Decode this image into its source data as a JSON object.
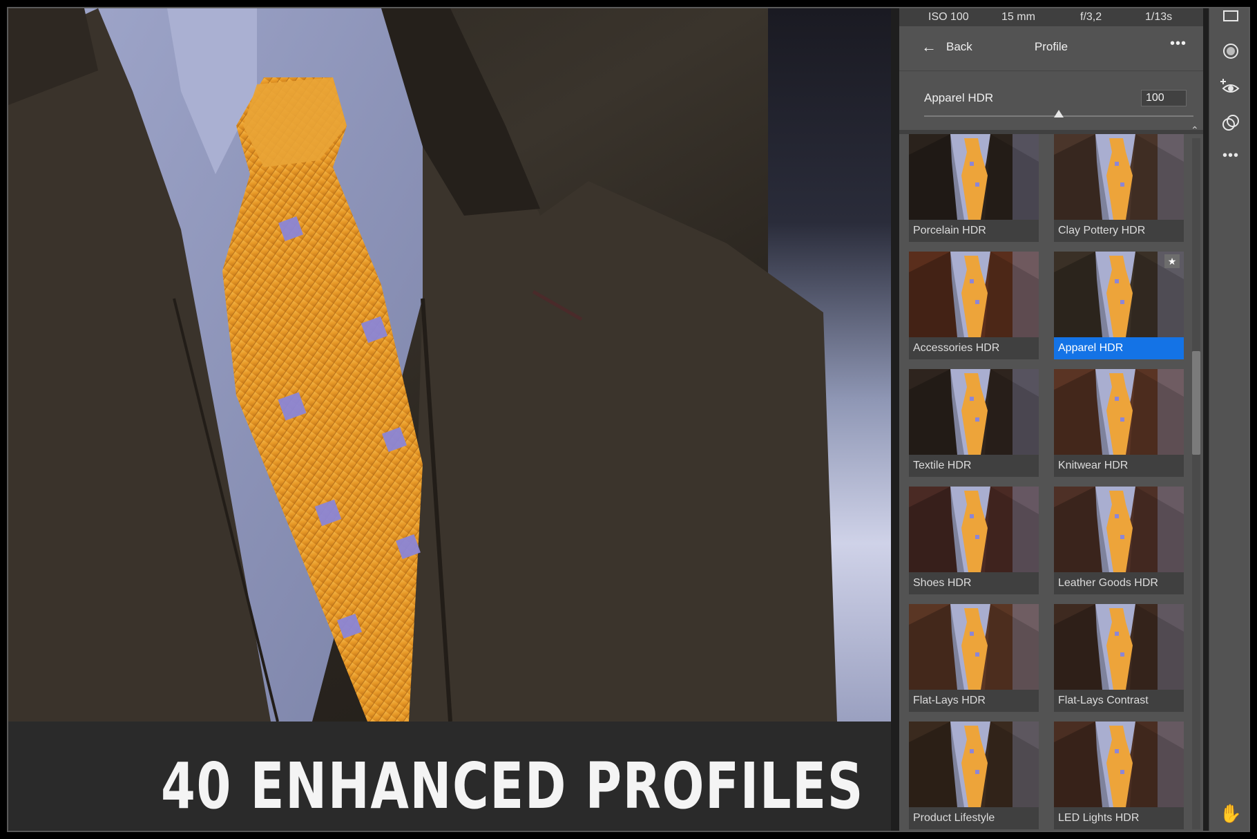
{
  "exif": {
    "iso": "ISO 100",
    "focal": "15 mm",
    "aperture": "f/3,2",
    "shutter": "1/13s"
  },
  "header": {
    "back_label": "Back",
    "title": "Profile",
    "more_label": "•••"
  },
  "amount": {
    "label": "Apparel HDR",
    "value": "100",
    "slider_fraction": 0.5
  },
  "profiles": [
    {
      "name": "Porcelain HDR",
      "tint": "#2a221c",
      "selected": false,
      "favorite": false
    },
    {
      "name": "Clay Pottery HDR",
      "tint": "#4a352a",
      "selected": false,
      "favorite": false
    },
    {
      "name": "Accessories HDR",
      "tint": "#5a2e1c",
      "selected": false,
      "favorite": false
    },
    {
      "name": "Apparel HDR",
      "tint": "#3a3026",
      "selected": true,
      "favorite": true
    },
    {
      "name": "Textile HDR",
      "tint": "#2e241e",
      "selected": false,
      "favorite": false
    },
    {
      "name": "Knitwear HDR",
      "tint": "#5a3424",
      "selected": false,
      "favorite": false
    },
    {
      "name": "Shoes HDR",
      "tint": "#4a2a24",
      "selected": false,
      "favorite": false
    },
    {
      "name": "Leather Goods HDR",
      "tint": "#4e3026",
      "selected": false,
      "favorite": false
    },
    {
      "name": "Flat-Lays HDR",
      "tint": "#5a3624",
      "selected": false,
      "favorite": false
    },
    {
      "name": "Flat-Lays Contrast",
      "tint": "#3e2a20",
      "selected": false,
      "favorite": false
    },
    {
      "name": "Product Lifestyle",
      "tint": "#3a2a1e",
      "selected": false,
      "favorite": false
    },
    {
      "name": "LED Lights HDR",
      "tint": "#4a2e22",
      "selected": false,
      "favorite": false
    }
  ],
  "caption": "40 ENHANCED PROFILES",
  "tools": [
    "square-icon",
    "circle-icon",
    "redeye-icon",
    "masking-icon",
    "more-icon",
    "hand-icon"
  ]
}
